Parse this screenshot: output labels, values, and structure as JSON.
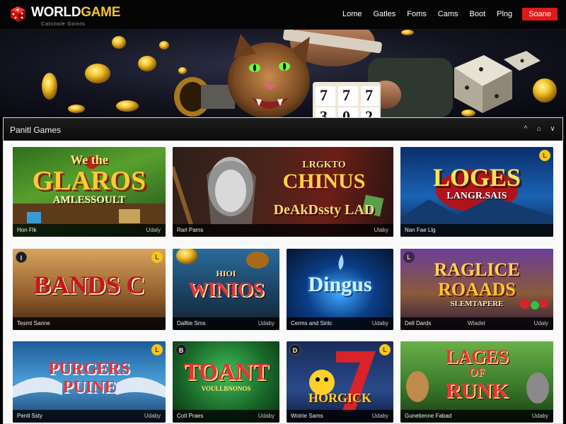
{
  "header": {
    "logo_text_1": "WORLD",
    "logo_text_2": "GAME",
    "logo_sub": "Catcoole Goints",
    "nav": [
      "Lome",
      "Gatles",
      "Foms",
      "Cams",
      "Boot",
      "Plng"
    ],
    "cta_label": "Soane"
  },
  "hero": {
    "sign_digits": [
      "7",
      "7",
      "7",
      "3",
      "0",
      "2"
    ]
  },
  "section": {
    "title": "Panitl Games",
    "controls": [
      "^",
      "⌂",
      "∨"
    ]
  },
  "colors": {
    "accent_red": "#e01a1a",
    "gold": "#f3c22a",
    "header_bg": "#050505",
    "panel_bg": "#fafafa"
  },
  "games": [
    {
      "title_lines": [
        "We the",
        "GLAROS",
        "AMLESSOULT"
      ],
      "caption_left": "Hon Flk",
      "caption_right": "Udaly",
      "badge": ""
    },
    {
      "title_lines": [
        "LRGKTO",
        "CHINUS",
        "DeAkDssty LAD"
      ],
      "caption_left": "Rarl Pams",
      "caption_right": "Ulaby",
      "badge": ""
    },
    {
      "title_lines": [
        "LOGES",
        "LANGR.SAIS"
      ],
      "caption_left": "Nan Fae Llg",
      "caption_right": "",
      "badge": "L"
    },
    {
      "title_lines": [
        "BANDS C"
      ],
      "caption_left": "Tesmt Sanne",
      "caption_right": "",
      "badge": "I",
      "badge2": "L"
    },
    {
      "title_lines": [
        "HIOI",
        "WINIOS"
      ],
      "caption_left": "Dalltie Sms",
      "caption_right": "Udaby",
      "badge": ""
    },
    {
      "title_lines": [
        "Dingus"
      ],
      "caption_left": "Cerms and Sinlc",
      "caption_right": "Udaby",
      "badge": ""
    },
    {
      "title_lines": [
        "RAGLICE",
        "ROAADS",
        "SLEMTAPERE"
      ],
      "caption_left": "Dell Dards",
      "caption_right": "Wladet",
      "caption_right2": "Udaly",
      "badge": "L"
    },
    {
      "title_lines": [
        "PURGERS",
        "PUINE"
      ],
      "caption_left": "Pentl Ssty",
      "caption_right": "Udaby",
      "badge": "L"
    },
    {
      "title_lines": [
        "TOANT",
        "VOULLBNONOS"
      ],
      "caption_left": "Cotl Praes",
      "caption_right": "Udaby",
      "badge": "B"
    },
    {
      "title_lines": [
        "HORGICK"
      ],
      "caption_left": "Wotrie Sams",
      "caption_right": "Udaby",
      "badge": "D",
      "badge2": "L"
    },
    {
      "title_lines": [
        "LAGES",
        "OF",
        "RUNK"
      ],
      "caption_left": "Gunetienne Fabad",
      "caption_right": "Udaby",
      "badge": ""
    }
  ]
}
